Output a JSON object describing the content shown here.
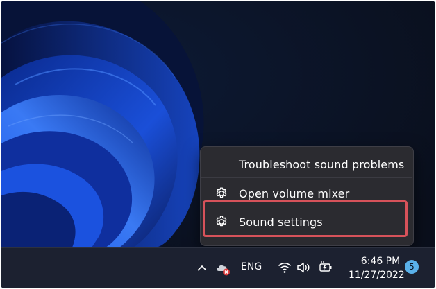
{
  "menu": {
    "items": [
      {
        "label": "Troubleshoot sound problems",
        "icon": null
      },
      {
        "label": "Open volume mixer",
        "icon": "gear-icon"
      },
      {
        "label": "Sound settings",
        "icon": "gear-icon",
        "highlighted": true
      }
    ],
    "highlight_color": "#d6525a"
  },
  "taskbar": {
    "language": "ENG",
    "time": "6:46 PM",
    "date": "11/27/2022",
    "notification_count": "5",
    "tray_icons": [
      "chevron-up-icon",
      "onedrive-error-icon",
      "wifi-icon",
      "speaker-icon",
      "battery-charging-icon"
    ]
  },
  "colors": {
    "accent": "#5ab1ea",
    "menu_bg": "#2b2b30",
    "taskbar_bg": "#1c2130"
  }
}
